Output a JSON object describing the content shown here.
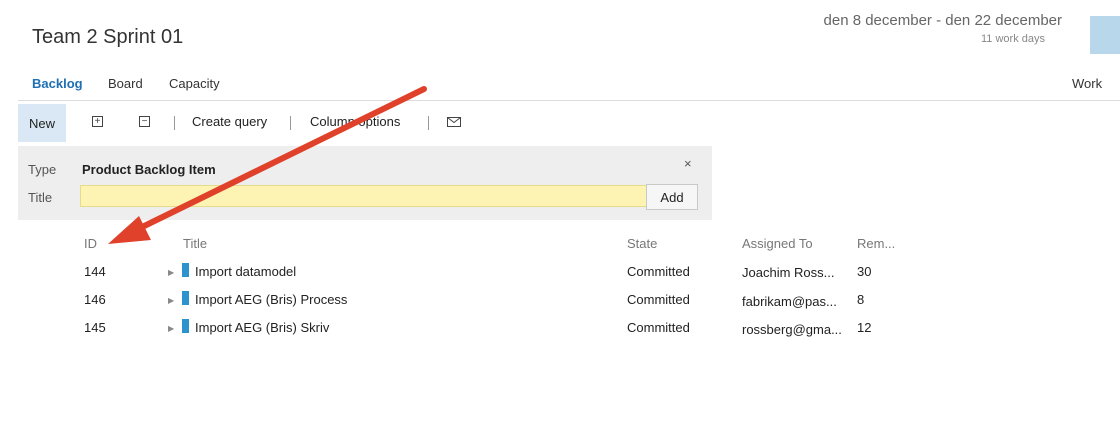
{
  "header": {
    "title": "Team 2 Sprint 01",
    "date_range": "den 8 december - den 22 december",
    "work_days": "11 work days"
  },
  "tabs": [
    {
      "label": "Backlog",
      "active": true
    },
    {
      "label": "Board",
      "active": false
    },
    {
      "label": "Capacity",
      "active": false
    }
  ],
  "right_link": "Work",
  "toolbar": {
    "new_label": "New",
    "expand_icon": "expand-all-icon",
    "collapse_icon": "collapse-all-icon",
    "create_query_label": "Create query",
    "column_options_label": "Column options",
    "email_icon": "mail-icon"
  },
  "quick_add": {
    "type_label": "Type",
    "type_value": "Product Backlog Item",
    "title_label": "Title",
    "title_value": "",
    "add_label": "Add",
    "close_symbol": "×"
  },
  "grid": {
    "columns": [
      "ID",
      "Title",
      "State",
      "Assigned To",
      "Rem..."
    ],
    "rows": [
      {
        "id": "144",
        "title": "Import datamodel",
        "state": "Committed",
        "assigned_to": "Joachim Ross...",
        "remaining": "30"
      },
      {
        "id": "146",
        "title": "Import AEG (Bris) Process",
        "state": "Committed",
        "assigned_to": "fabrikam@pas...",
        "remaining": "8"
      },
      {
        "id": "145",
        "title": "Import AEG (Bris) Skriv",
        "state": "Committed",
        "assigned_to": "rossberg@gma...",
        "remaining": "12"
      }
    ]
  },
  "colors": {
    "accent": "#1e6fb3",
    "work_item_bar": "#2e92cf",
    "title_input_bg": "#fdf4b3",
    "annotation_arrow": "#e0412b"
  }
}
